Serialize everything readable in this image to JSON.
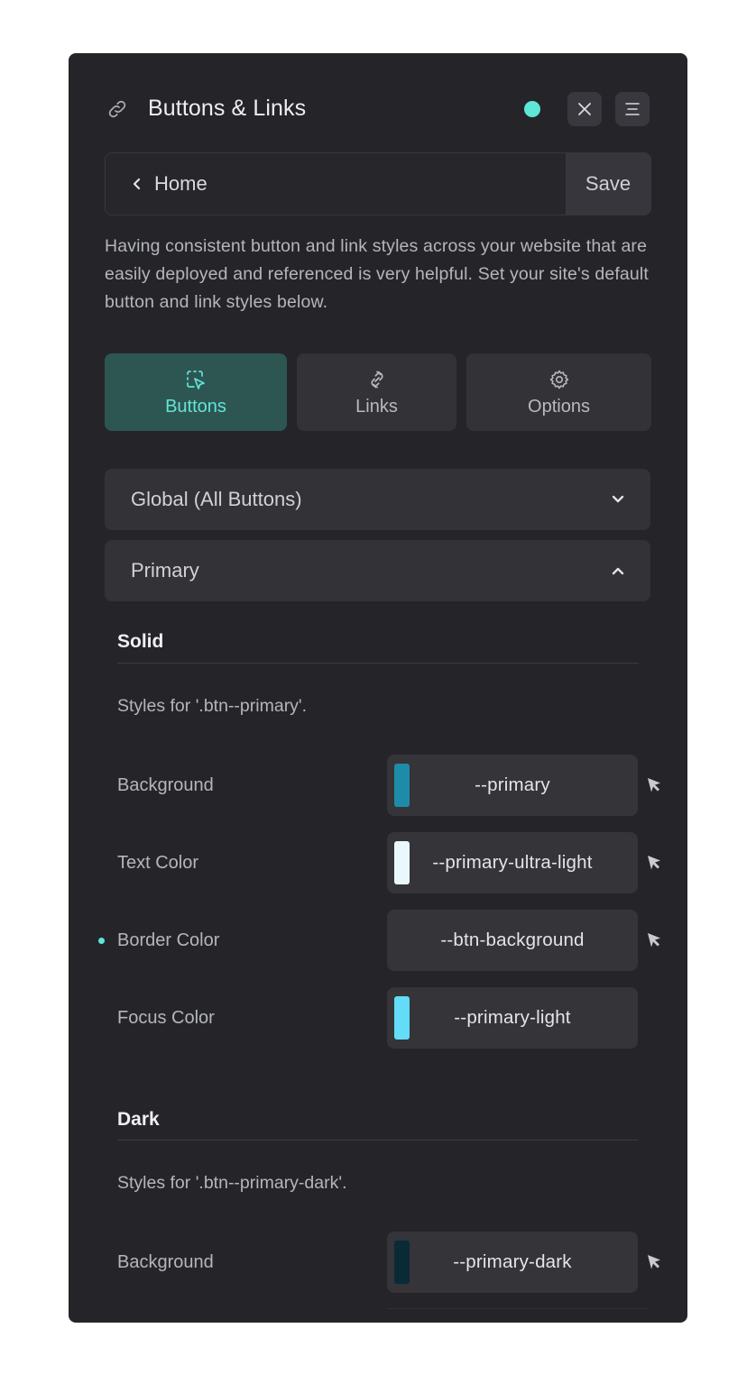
{
  "header": {
    "title": "Buttons & Links",
    "icon": "link-icon",
    "status_color": "#5ee6d7"
  },
  "breadcrumb": {
    "back_label": "Home",
    "save_label": "Save"
  },
  "description": "Having consistent button and link styles across your website that are easily deployed and referenced is very helpful. Set your site's default button and link styles below.",
  "tabs": [
    {
      "label": "Buttons",
      "icon": "pointer-select-icon",
      "active": true
    },
    {
      "label": "Links",
      "icon": "chain-link-icon",
      "active": false
    },
    {
      "label": "Options",
      "icon": "gear-icon",
      "active": false
    }
  ],
  "accordions": [
    {
      "label": "Global (All Buttons)",
      "expanded": false
    },
    {
      "label": "Primary",
      "expanded": true
    }
  ],
  "sections": {
    "solid": {
      "title": "Solid",
      "description": "Styles for '.btn--primary'.",
      "rows": [
        {
          "label": "Background",
          "value": "--primary",
          "swatch": "#1e8ca8",
          "modified": false
        },
        {
          "label": "Text Color",
          "value": "--primary-ultra-light",
          "swatch": "#eaf8fd",
          "modified": false
        },
        {
          "label": "Border Color",
          "value": "--btn-background",
          "swatch": "",
          "modified": true
        },
        {
          "label": "Focus Color",
          "value": "--primary-light",
          "swatch": "#62dcf7",
          "modified": false
        }
      ]
    },
    "dark": {
      "title": "Dark",
      "description": "Styles for '.btn--primary-dark'.",
      "rows": [
        {
          "label": "Background",
          "value": "--primary-dark",
          "swatch": "#0a2a36",
          "modified": false
        }
      ]
    }
  },
  "colors": {
    "panel_bg": "#252529",
    "accent": "#5ee6d7",
    "active_tab_bg": "#2d5653"
  }
}
